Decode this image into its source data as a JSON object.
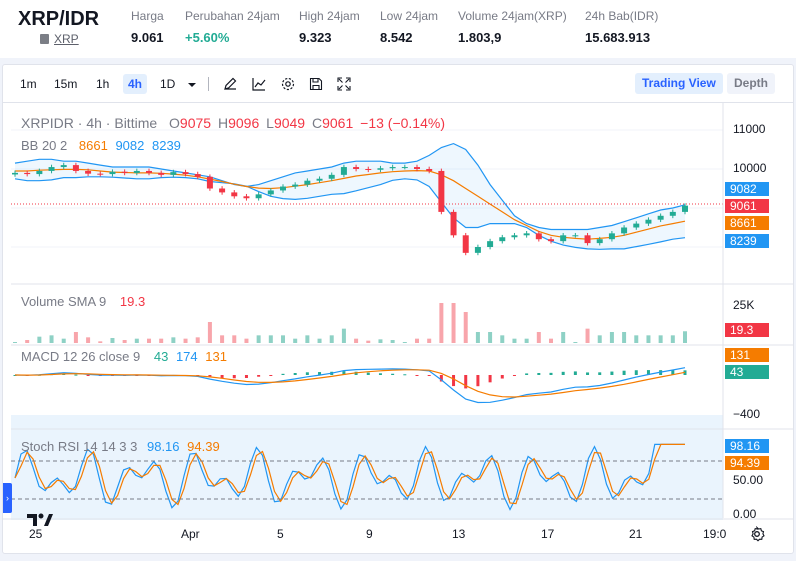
{
  "header": {
    "pair": "XRP/IDR",
    "coin_link": "XRP",
    "stats": [
      {
        "label": "Harga",
        "value": "9.061"
      },
      {
        "label": "Perubahan 24jam",
        "value": "+5.60%"
      },
      {
        "label": "High 24jam",
        "value": "9.323"
      },
      {
        "label": "Low 24jam",
        "value": "8.542"
      },
      {
        "label": "Volume 24jam(XRP)",
        "value": "1.803,9"
      },
      {
        "label": "24h Bab(IDR)",
        "value": "15.683.913"
      }
    ]
  },
  "toolbar": {
    "timeframes": [
      "1m",
      "15m",
      "1h",
      "4h",
      "1D"
    ],
    "active_timeframe": "4h",
    "trading_view": "Trading View",
    "depth": "Depth"
  },
  "legend": {
    "symbol": "XRPIDR · 4h · Bittime",
    "o_key": "O",
    "o": "9075",
    "h_key": "H",
    "h": "9096",
    "l_key": "L",
    "l": "9049",
    "c_key": "C",
    "c": "9061",
    "change": "−13 (−0.14%)",
    "bb_label": "BB 20 2",
    "bb_basis": "8661",
    "bb_upper": "9082",
    "bb_lower": "8239",
    "vol_label": "Volume SMA 9",
    "vol_value": "19.3",
    "macd_label": "MACD 12 26 close 9",
    "macd_hist": "43",
    "macd_line": "174",
    "macd_signal": "131",
    "stoch_label": "Stoch RSI 14 14 3 3",
    "stoch_k": "98.16",
    "stoch_d": "94.39"
  },
  "price_axis": {
    "ticks": [
      "11000",
      "10000"
    ],
    "vol_tick": "25K",
    "macd_tick": "−400",
    "stoch_ticks": [
      "50.00",
      "0.00"
    ],
    "tags": {
      "upper": "9082",
      "last": "9061",
      "basis": "8661",
      "lower": "8239",
      "vol": "19.3",
      "macd_signal": "131",
      "macd_hist": "43",
      "stoch_k": "98.16",
      "stoch_d": "94.39"
    }
  },
  "time_axis": [
    "25",
    "Apr",
    "5",
    "9",
    "13",
    "17",
    "21",
    "19:0"
  ],
  "colors": {
    "up": "#22ab94",
    "down": "#f23645",
    "bb_upper": "#2196f3",
    "bb_basis": "#f57c00",
    "bb_lower": "#2196f3",
    "accent": "#2962ff"
  },
  "chart_data": {
    "type": "candlestick",
    "ohlc_last": {
      "open": 9075,
      "high": 9096,
      "low": 9049,
      "close": 9061
    },
    "close_series_approx": [
      9900,
      9870,
      9950,
      10050,
      10100,
      9950,
      9880,
      9870,
      9930,
      9900,
      9950,
      9900,
      9850,
      9920,
      9870,
      9800,
      9500,
      9400,
      9300,
      9250,
      9350,
      9450,
      9550,
      9600,
      9700,
      9750,
      9850,
      10050,
      10000,
      9980,
      10020,
      10050,
      10050,
      10000,
      9950,
      8900,
      8300,
      7850,
      8000,
      8150,
      8250,
      8300,
      8350,
      8200,
      8150,
      8300,
      8300,
      8100,
      8200,
      8350,
      8500,
      8600,
      8700,
      8800,
      8900,
      9061
    ],
    "bb_upper_approx": [
      10150,
      10200,
      10250,
      10250,
      10200,
      10200,
      10150,
      10100,
      10050,
      10050,
      10050,
      10050,
      10000,
      9950,
      9900,
      9850,
      9800,
      9700,
      9600,
      9550,
      9600,
      9700,
      9800,
      9900,
      9950,
      10000,
      10050,
      10150,
      10200,
      10200,
      10200,
      10150,
      10150,
      10200,
      10350,
      10550,
      10650,
      10500,
      10100,
      9600,
      9200,
      8800,
      8600,
      8500,
      8450,
      8450,
      8450,
      8450,
      8500,
      8550,
      8650,
      8750,
      8850,
      8950,
      9000,
      9082
    ],
    "bb_basis_approx": [
      9950,
      9950,
      9970,
      9980,
      9990,
      9990,
      9980,
      9950,
      9920,
      9910,
      9900,
      9900,
      9890,
      9870,
      9840,
      9800,
      9740,
      9680,
      9610,
      9550,
      9510,
      9500,
      9520,
      9560,
      9600,
      9650,
      9700,
      9760,
      9820,
      9860,
      9900,
      9930,
      9950,
      9960,
      9950,
      9850,
      9700,
      9500,
      9300,
      9100,
      8900,
      8700,
      8550,
      8400,
      8300,
      8250,
      8220,
      8200,
      8220,
      8250,
      8300,
      8380,
      8460,
      8540,
      8600,
      8661
    ],
    "bb_lower_approx": [
      9750,
      9700,
      9700,
      9720,
      9780,
      9780,
      9800,
      9800,
      9790,
      9770,
      9750,
      9750,
      9780,
      9790,
      9780,
      9750,
      9680,
      9650,
      9620,
      9560,
      9420,
      9300,
      9240,
      9220,
      9250,
      9300,
      9350,
      9370,
      9440,
      9520,
      9600,
      9710,
      9750,
      9720,
      9550,
      9150,
      8750,
      8500,
      8500,
      8600,
      8600,
      8600,
      8500,
      8300,
      8150,
      8050,
      7990,
      7950,
      7940,
      7950,
      7950,
      8010,
      8070,
      8130,
      8200,
      8239
    ],
    "volume_sma": 19.3,
    "macd": {
      "line": 174,
      "signal": 131,
      "histogram": 43
    },
    "stoch_rsi": {
      "k": 98.16,
      "d": 94.39
    }
  }
}
